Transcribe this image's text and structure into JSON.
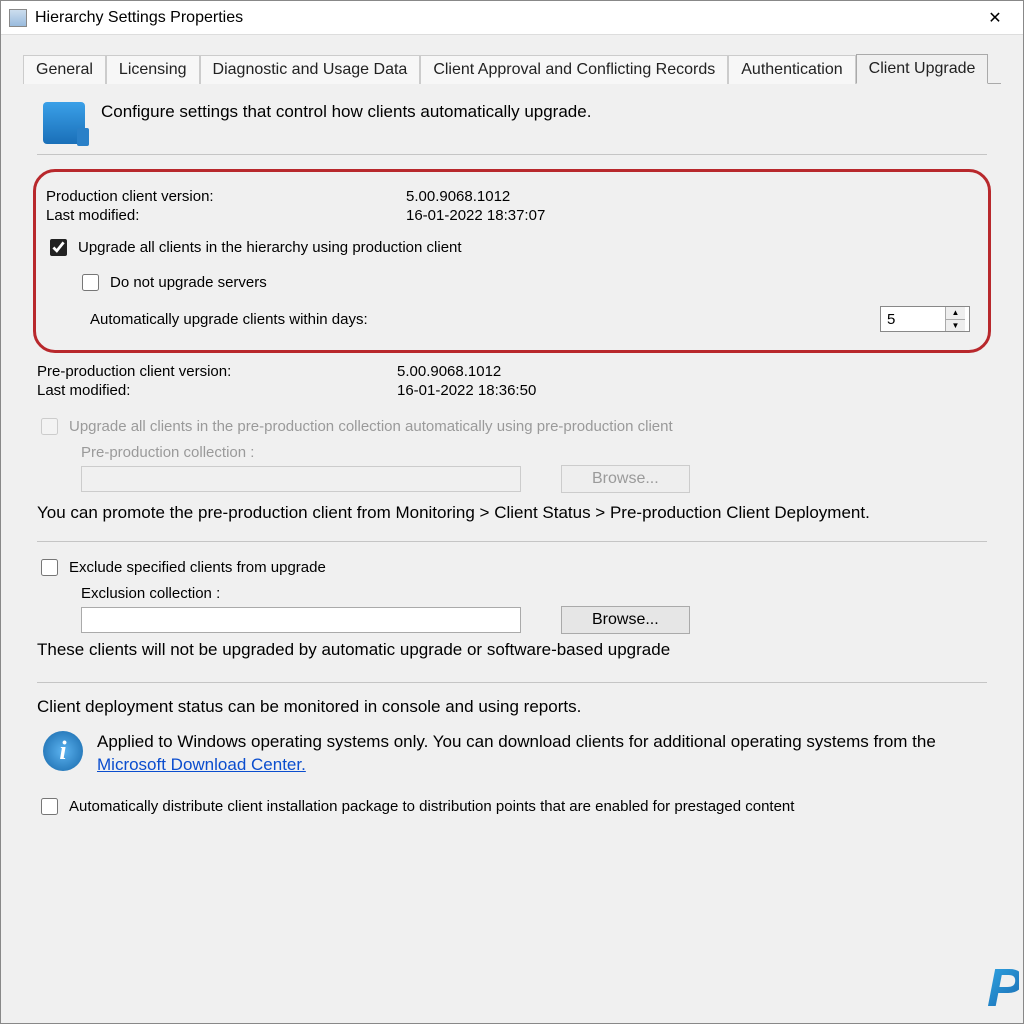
{
  "window": {
    "title": "Hierarchy Settings Properties",
    "close": "✕"
  },
  "tabs": [
    "General",
    "Licensing",
    "Diagnostic and Usage Data",
    "Client Approval and Conflicting Records",
    "Authentication",
    "Client Upgrade"
  ],
  "active_tab_index": 5,
  "intro": "Configure settings that control how clients automatically upgrade.",
  "production": {
    "version_label": "Production client version:",
    "version_value": "5.00.9068.1012",
    "modified_label": "Last modified:",
    "modified_value": "16-01-2022 18:37:07",
    "upgrade_all_label": "Upgrade all clients in the hierarchy using production client",
    "upgrade_all_checked": true,
    "do_not_upgrade_servers_label": "Do not upgrade servers",
    "do_not_upgrade_servers_checked": false,
    "auto_days_label": "Automatically upgrade clients within days:",
    "auto_days_value": "5"
  },
  "preproduction": {
    "version_label": "Pre-production client version:",
    "version_value": "5.00.9068.1012",
    "modified_label": "Last modified:",
    "modified_value": "16-01-2022 18:36:50",
    "upgrade_all_label": "Upgrade all clients in the pre-production collection automatically using pre-production client",
    "collection_label": "Pre-production collection :",
    "browse_label": "Browse...",
    "promote_note": "You can promote the pre-production client from Monitoring > Client Status > Pre-production Client Deployment."
  },
  "exclusion": {
    "exclude_label": "Exclude specified clients from upgrade",
    "collection_label": "Exclusion collection :",
    "browse_label": "Browse...",
    "note": "These clients will not be upgraded by automatic upgrade or software-based upgrade"
  },
  "deployment": {
    "status_note": "Client deployment status can be monitored in console and using reports.",
    "info_text_prefix": "Applied to Windows operating systems only. You can download clients for additional operating systems from the ",
    "info_link": "Microsoft Download Center.",
    "auto_distribute_label": "Automatically distribute client installation package to distribution points that are enabled for prestaged content"
  },
  "watermark": "P"
}
